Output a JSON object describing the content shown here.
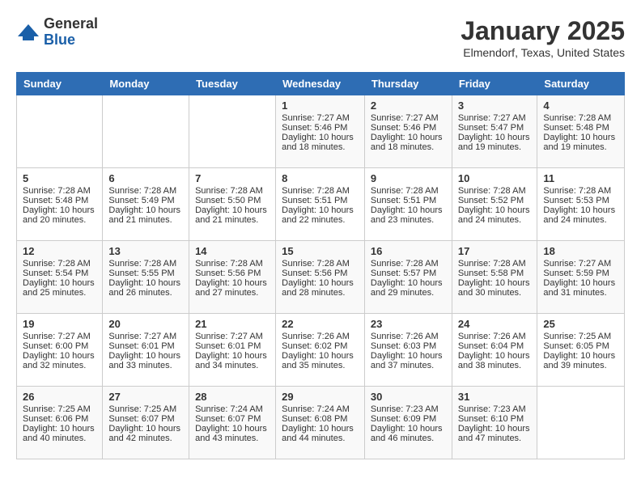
{
  "header": {
    "logo_general": "General",
    "logo_blue": "Blue",
    "month_title": "January 2025",
    "location": "Elmendorf, Texas, United States"
  },
  "weekdays": [
    "Sunday",
    "Monday",
    "Tuesday",
    "Wednesday",
    "Thursday",
    "Friday",
    "Saturday"
  ],
  "weeks": [
    [
      {
        "day": "",
        "info": ""
      },
      {
        "day": "",
        "info": ""
      },
      {
        "day": "",
        "info": ""
      },
      {
        "day": "1",
        "info": "Sunrise: 7:27 AM\nSunset: 5:46 PM\nDaylight: 10 hours\nand 18 minutes."
      },
      {
        "day": "2",
        "info": "Sunrise: 7:27 AM\nSunset: 5:46 PM\nDaylight: 10 hours\nand 18 minutes."
      },
      {
        "day": "3",
        "info": "Sunrise: 7:27 AM\nSunset: 5:47 PM\nDaylight: 10 hours\nand 19 minutes."
      },
      {
        "day": "4",
        "info": "Sunrise: 7:28 AM\nSunset: 5:48 PM\nDaylight: 10 hours\nand 19 minutes."
      }
    ],
    [
      {
        "day": "5",
        "info": "Sunrise: 7:28 AM\nSunset: 5:48 PM\nDaylight: 10 hours\nand 20 minutes."
      },
      {
        "day": "6",
        "info": "Sunrise: 7:28 AM\nSunset: 5:49 PM\nDaylight: 10 hours\nand 21 minutes."
      },
      {
        "day": "7",
        "info": "Sunrise: 7:28 AM\nSunset: 5:50 PM\nDaylight: 10 hours\nand 21 minutes."
      },
      {
        "day": "8",
        "info": "Sunrise: 7:28 AM\nSunset: 5:51 PM\nDaylight: 10 hours\nand 22 minutes."
      },
      {
        "day": "9",
        "info": "Sunrise: 7:28 AM\nSunset: 5:51 PM\nDaylight: 10 hours\nand 23 minutes."
      },
      {
        "day": "10",
        "info": "Sunrise: 7:28 AM\nSunset: 5:52 PM\nDaylight: 10 hours\nand 24 minutes."
      },
      {
        "day": "11",
        "info": "Sunrise: 7:28 AM\nSunset: 5:53 PM\nDaylight: 10 hours\nand 24 minutes."
      }
    ],
    [
      {
        "day": "12",
        "info": "Sunrise: 7:28 AM\nSunset: 5:54 PM\nDaylight: 10 hours\nand 25 minutes."
      },
      {
        "day": "13",
        "info": "Sunrise: 7:28 AM\nSunset: 5:55 PM\nDaylight: 10 hours\nand 26 minutes."
      },
      {
        "day": "14",
        "info": "Sunrise: 7:28 AM\nSunset: 5:56 PM\nDaylight: 10 hours\nand 27 minutes."
      },
      {
        "day": "15",
        "info": "Sunrise: 7:28 AM\nSunset: 5:56 PM\nDaylight: 10 hours\nand 28 minutes."
      },
      {
        "day": "16",
        "info": "Sunrise: 7:28 AM\nSunset: 5:57 PM\nDaylight: 10 hours\nand 29 minutes."
      },
      {
        "day": "17",
        "info": "Sunrise: 7:28 AM\nSunset: 5:58 PM\nDaylight: 10 hours\nand 30 minutes."
      },
      {
        "day": "18",
        "info": "Sunrise: 7:27 AM\nSunset: 5:59 PM\nDaylight: 10 hours\nand 31 minutes."
      }
    ],
    [
      {
        "day": "19",
        "info": "Sunrise: 7:27 AM\nSunset: 6:00 PM\nDaylight: 10 hours\nand 32 minutes."
      },
      {
        "day": "20",
        "info": "Sunrise: 7:27 AM\nSunset: 6:01 PM\nDaylight: 10 hours\nand 33 minutes."
      },
      {
        "day": "21",
        "info": "Sunrise: 7:27 AM\nSunset: 6:01 PM\nDaylight: 10 hours\nand 34 minutes."
      },
      {
        "day": "22",
        "info": "Sunrise: 7:26 AM\nSunset: 6:02 PM\nDaylight: 10 hours\nand 35 minutes."
      },
      {
        "day": "23",
        "info": "Sunrise: 7:26 AM\nSunset: 6:03 PM\nDaylight: 10 hours\nand 37 minutes."
      },
      {
        "day": "24",
        "info": "Sunrise: 7:26 AM\nSunset: 6:04 PM\nDaylight: 10 hours\nand 38 minutes."
      },
      {
        "day": "25",
        "info": "Sunrise: 7:25 AM\nSunset: 6:05 PM\nDaylight: 10 hours\nand 39 minutes."
      }
    ],
    [
      {
        "day": "26",
        "info": "Sunrise: 7:25 AM\nSunset: 6:06 PM\nDaylight: 10 hours\nand 40 minutes."
      },
      {
        "day": "27",
        "info": "Sunrise: 7:25 AM\nSunset: 6:07 PM\nDaylight: 10 hours\nand 42 minutes."
      },
      {
        "day": "28",
        "info": "Sunrise: 7:24 AM\nSunset: 6:07 PM\nDaylight: 10 hours\nand 43 minutes."
      },
      {
        "day": "29",
        "info": "Sunrise: 7:24 AM\nSunset: 6:08 PM\nDaylight: 10 hours\nand 44 minutes."
      },
      {
        "day": "30",
        "info": "Sunrise: 7:23 AM\nSunset: 6:09 PM\nDaylight: 10 hours\nand 46 minutes."
      },
      {
        "day": "31",
        "info": "Sunrise: 7:23 AM\nSunset: 6:10 PM\nDaylight: 10 hours\nand 47 minutes."
      },
      {
        "day": "",
        "info": ""
      }
    ]
  ]
}
